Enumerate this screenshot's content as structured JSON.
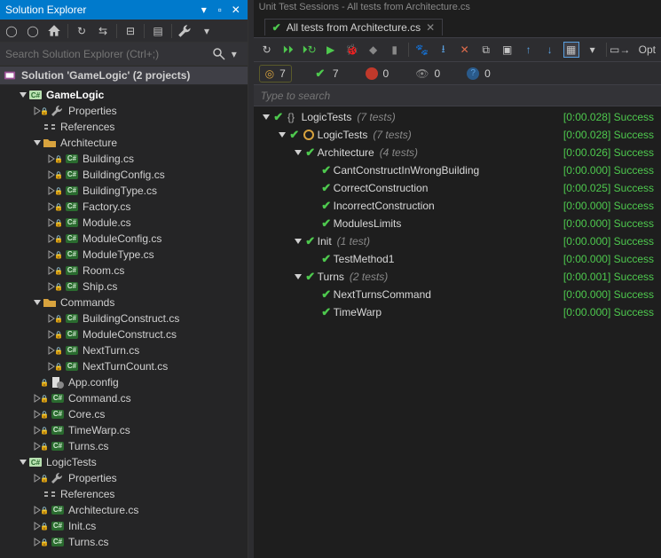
{
  "solutionExplorer": {
    "title": "Solution Explorer",
    "searchPlaceholder": "Search Solution Explorer (Ctrl+;)",
    "solutionLine": "Solution 'GameLogic' (2 projects)",
    "tree": [
      {
        "d": 1,
        "exp": "open",
        "icon": "proj",
        "label": "GameLogic",
        "bold": true
      },
      {
        "d": 2,
        "exp": "closed",
        "icon": "wrench",
        "lock": true,
        "label": "Properties"
      },
      {
        "d": 2,
        "exp": "none",
        "icon": "refs",
        "label": "References"
      },
      {
        "d": 2,
        "exp": "open",
        "icon": "folder",
        "label": "Architecture"
      },
      {
        "d": 3,
        "exp": "closed",
        "icon": "cs",
        "lock": true,
        "label": "Building.cs"
      },
      {
        "d": 3,
        "exp": "closed",
        "icon": "cs",
        "lock": true,
        "label": "BuildingConfig.cs"
      },
      {
        "d": 3,
        "exp": "closed",
        "icon": "cs",
        "lock": true,
        "label": "BuildingType.cs"
      },
      {
        "d": 3,
        "exp": "closed",
        "icon": "cs",
        "lock": true,
        "label": "Factory.cs"
      },
      {
        "d": 3,
        "exp": "closed",
        "icon": "cs",
        "lock": true,
        "label": "Module.cs"
      },
      {
        "d": 3,
        "exp": "closed",
        "icon": "cs",
        "lock": true,
        "label": "ModuleConfig.cs"
      },
      {
        "d": 3,
        "exp": "closed",
        "icon": "cs",
        "lock": true,
        "label": "ModuleType.cs"
      },
      {
        "d": 3,
        "exp": "closed",
        "icon": "cs",
        "lock": true,
        "label": "Room.cs"
      },
      {
        "d": 3,
        "exp": "closed",
        "icon": "cs",
        "lock": true,
        "label": "Ship.cs"
      },
      {
        "d": 2,
        "exp": "open",
        "icon": "folder",
        "label": "Commands"
      },
      {
        "d": 3,
        "exp": "closed",
        "icon": "cs",
        "lock": true,
        "label": "BuildingConstruct.cs"
      },
      {
        "d": 3,
        "exp": "closed",
        "icon": "cs",
        "lock": true,
        "label": "ModuleConstruct.cs"
      },
      {
        "d": 3,
        "exp": "closed",
        "icon": "cs",
        "lock": true,
        "label": "NextTurn.cs"
      },
      {
        "d": 3,
        "exp": "closed",
        "icon": "cs",
        "lock": true,
        "label": "NextTurnCount.cs"
      },
      {
        "d": 2,
        "exp": "none",
        "icon": "cfg",
        "lock": true,
        "label": "App.config"
      },
      {
        "d": 2,
        "exp": "closed",
        "icon": "cs",
        "lock": true,
        "label": "Command.cs"
      },
      {
        "d": 2,
        "exp": "closed",
        "icon": "cs",
        "lock": true,
        "label": "Core.cs"
      },
      {
        "d": 2,
        "exp": "closed",
        "icon": "cs",
        "lock": true,
        "label": "TimeWarp.cs"
      },
      {
        "d": 2,
        "exp": "closed",
        "icon": "cs",
        "lock": true,
        "label": "Turns.cs"
      },
      {
        "d": 1,
        "exp": "open",
        "icon": "proj",
        "label": "LogicTests",
        "bold": false
      },
      {
        "d": 2,
        "exp": "closed",
        "icon": "wrench",
        "lock": true,
        "label": "Properties"
      },
      {
        "d": 2,
        "exp": "none",
        "icon": "refs",
        "label": "References"
      },
      {
        "d": 2,
        "exp": "closed",
        "icon": "cs",
        "lock": true,
        "label": "Architecture.cs"
      },
      {
        "d": 2,
        "exp": "closed",
        "icon": "cs",
        "lock": true,
        "label": "Init.cs"
      },
      {
        "d": 2,
        "exp": "closed",
        "icon": "cs",
        "lock": true,
        "label": "Turns.cs"
      }
    ]
  },
  "testSessions": {
    "windowTitle": "Unit Test Sessions - All tests from Architecture.cs",
    "tabLabel": "All tests from Architecture.cs",
    "searchPlaceholder": "Type to search",
    "optionsLabel": "Opt",
    "counts": {
      "broken": "7",
      "passed": "7",
      "failed": "0",
      "ignored": "0",
      "unknown": "0"
    },
    "results": [
      {
        "d": 0,
        "exp": "open",
        "icon": "ns",
        "name": "LogicTests",
        "meta": "(7 tests)",
        "time": "[0:00.028]",
        "status": "Success"
      },
      {
        "d": 1,
        "exp": "open",
        "icon": "class",
        "name": "LogicTests",
        "meta": "(7 tests)",
        "time": "[0:00.028]",
        "status": "Success"
      },
      {
        "d": 2,
        "exp": "open",
        "icon": "none",
        "name": "Architecture",
        "meta": "(4 tests)",
        "time": "[0:00.026]",
        "status": "Success"
      },
      {
        "d": 3,
        "exp": "none",
        "icon": "none",
        "name": "CantConstructInWrongBuilding",
        "meta": "",
        "time": "[0:00.000]",
        "status": "Success"
      },
      {
        "d": 3,
        "exp": "none",
        "icon": "none",
        "name": "CorrectConstruction",
        "meta": "",
        "time": "[0:00.025]",
        "status": "Success"
      },
      {
        "d": 3,
        "exp": "none",
        "icon": "none",
        "name": "IncorrectConstruction",
        "meta": "",
        "time": "[0:00.000]",
        "status": "Success"
      },
      {
        "d": 3,
        "exp": "none",
        "icon": "none",
        "name": "ModulesLimits",
        "meta": "",
        "time": "[0:00.000]",
        "status": "Success"
      },
      {
        "d": 2,
        "exp": "open",
        "icon": "none",
        "name": "Init",
        "meta": "(1 test)",
        "time": "[0:00.000]",
        "status": "Success"
      },
      {
        "d": 3,
        "exp": "none",
        "icon": "none",
        "name": "TestMethod1",
        "meta": "",
        "time": "[0:00.000]",
        "status": "Success"
      },
      {
        "d": 2,
        "exp": "open",
        "icon": "none",
        "name": "Turns",
        "meta": "(2 tests)",
        "time": "[0:00.001]",
        "status": "Success"
      },
      {
        "d": 3,
        "exp": "none",
        "icon": "none",
        "name": "NextTurnsCommand",
        "meta": "",
        "time": "[0:00.000]",
        "status": "Success"
      },
      {
        "d": 3,
        "exp": "none",
        "icon": "none",
        "name": "TimeWarp",
        "meta": "",
        "time": "[0:00.000]",
        "status": "Success"
      }
    ]
  }
}
